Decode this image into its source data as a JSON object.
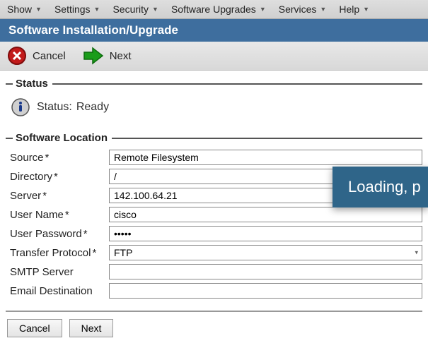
{
  "menubar": {
    "items": [
      {
        "label": "Show"
      },
      {
        "label": "Settings"
      },
      {
        "label": "Security"
      },
      {
        "label": "Software Upgrades"
      },
      {
        "label": "Services"
      },
      {
        "label": "Help"
      }
    ]
  },
  "page": {
    "title": "Software Installation/Upgrade"
  },
  "toolbar": {
    "cancel": "Cancel",
    "next": "Next"
  },
  "status_section": {
    "legend": "Status",
    "status_label": "Status:",
    "status_value": "Ready"
  },
  "location_section": {
    "legend": "Software Location",
    "fields": {
      "source_label": "Source",
      "source_value": "Remote Filesystem",
      "directory_label": "Directory",
      "directory_value": "/",
      "server_label": "Server",
      "server_value": "142.100.64.21",
      "username_label": "User Name",
      "username_value": "cisco",
      "password_label": "User Password",
      "password_value": "•••••",
      "protocol_label": "Transfer Protocol",
      "protocol_value": "FTP",
      "smtp_label": "SMTP Server",
      "smtp_value": "",
      "email_label": "Email Destination",
      "email_value": ""
    }
  },
  "footer": {
    "cancel": "Cancel",
    "next": "Next"
  },
  "overlay": {
    "text": "Loading, p"
  }
}
